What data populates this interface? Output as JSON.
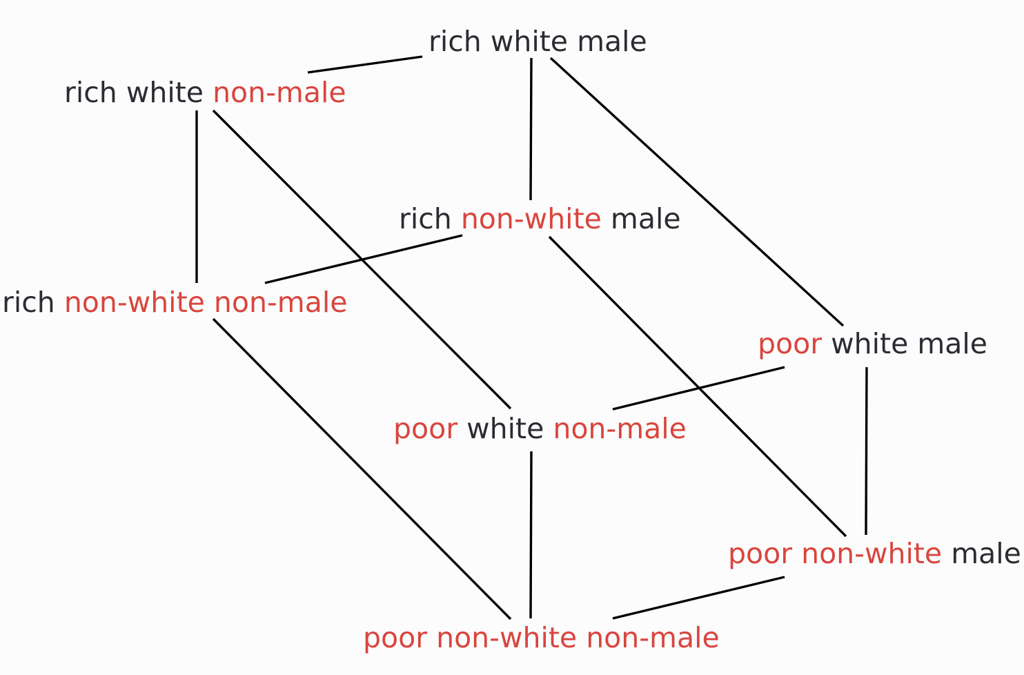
{
  "colors": {
    "plain": "#2b2b33",
    "negated": "#d9453e",
    "edge": "#000000",
    "background": "#fcfcfc"
  },
  "nodes": [
    {
      "id": "rich-white-male",
      "words": [
        {
          "text": "rich",
          "negated": false
        },
        {
          "text": "white",
          "negated": false
        },
        {
          "text": "male",
          "negated": false
        }
      ]
    },
    {
      "id": "rich-white-non-male",
      "words": [
        {
          "text": "rich",
          "negated": false
        },
        {
          "text": "white",
          "negated": false
        },
        {
          "text": "non-male",
          "negated": true
        }
      ]
    },
    {
      "id": "rich-non-white-male",
      "words": [
        {
          "text": "rich",
          "negated": false
        },
        {
          "text": "non-white",
          "negated": true
        },
        {
          "text": "male",
          "negated": false
        }
      ]
    },
    {
      "id": "rich-non-white-non-male",
      "words": [
        {
          "text": "rich",
          "negated": false
        },
        {
          "text": "non-white",
          "negated": true
        },
        {
          "text": "non-male",
          "negated": true
        }
      ]
    },
    {
      "id": "poor-white-male",
      "words": [
        {
          "text": "poor",
          "negated": true
        },
        {
          "text": "white",
          "negated": false
        },
        {
          "text": "male",
          "negated": false
        }
      ]
    },
    {
      "id": "poor-white-non-male",
      "words": [
        {
          "text": "poor",
          "negated": true
        },
        {
          "text": "white",
          "negated": false
        },
        {
          "text": "non-male",
          "negated": true
        }
      ]
    },
    {
      "id": "poor-non-white-male",
      "words": [
        {
          "text": "poor",
          "negated": true
        },
        {
          "text": "non-white",
          "negated": true
        },
        {
          "text": "male",
          "negated": false
        }
      ]
    },
    {
      "id": "poor-non-white-non-male",
      "words": [
        {
          "text": "poor",
          "negated": true
        },
        {
          "text": "non-white",
          "negated": true
        },
        {
          "text": "non-male",
          "negated": true
        }
      ]
    }
  ],
  "edges": [
    {
      "from": "rich-white-male",
      "to": "rich-white-non-male"
    },
    {
      "from": "rich-white-male",
      "to": "rich-non-white-male"
    },
    {
      "from": "rich-white-male",
      "to": "poor-white-male"
    },
    {
      "from": "rich-white-non-male",
      "to": "rich-non-white-non-male"
    },
    {
      "from": "rich-white-non-male",
      "to": "poor-white-non-male"
    },
    {
      "from": "rich-non-white-male",
      "to": "rich-non-white-non-male"
    },
    {
      "from": "rich-non-white-male",
      "to": "poor-non-white-male"
    },
    {
      "from": "rich-non-white-non-male",
      "to": "poor-non-white-non-male"
    },
    {
      "from": "poor-white-male",
      "to": "poor-white-non-male"
    },
    {
      "from": "poor-white-male",
      "to": "poor-non-white-male"
    },
    {
      "from": "poor-white-non-male",
      "to": "poor-non-white-non-male"
    },
    {
      "from": "poor-non-white-male",
      "to": "poor-non-white-non-male"
    }
  ]
}
